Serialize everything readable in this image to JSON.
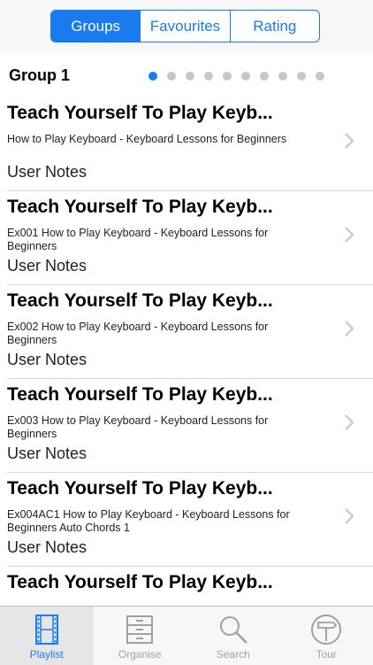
{
  "segments": [
    {
      "label": "Groups",
      "active": true
    },
    {
      "label": "Favourites",
      "active": false
    },
    {
      "label": "Rating",
      "active": false
    }
  ],
  "group": {
    "title": "Group 1",
    "page_count": 10,
    "active_page": 1
  },
  "rows": [
    {
      "title": "Teach Yourself To Play Keyb...",
      "subtitle": "How to Play Keyboard - Keyboard Lessons for Beginners",
      "notes": "User Notes"
    },
    {
      "title": "Teach Yourself To Play Keyb...",
      "subtitle": "Ex001 How to Play Keyboard - Keyboard Lessons for Beginners",
      "notes": "User Notes"
    },
    {
      "title": "Teach Yourself To Play Keyb...",
      "subtitle": "Ex002 How to Play Keyboard - Keyboard Lessons for Beginners",
      "notes": "User Notes"
    },
    {
      "title": "Teach Yourself To Play Keyb...",
      "subtitle": "Ex003 How to Play Keyboard - Keyboard Lessons for Beginners",
      "notes": "User Notes"
    },
    {
      "title": "Teach Yourself To Play Keyb...",
      "subtitle": "Ex004AC1 How to Play Keyboard - Keyboard Lessons for Beginners  Auto Chords 1",
      "notes": "User Notes"
    },
    {
      "title": "Teach Yourself To Play Keyb...",
      "subtitle": "",
      "notes": ""
    }
  ],
  "tabs": {
    "playlist": "Playlist",
    "organise": "Organise",
    "search": "Search",
    "tour": "Tour"
  },
  "colors": {
    "accent": "#1a7bf0",
    "inactive": "#a0a0a0"
  }
}
